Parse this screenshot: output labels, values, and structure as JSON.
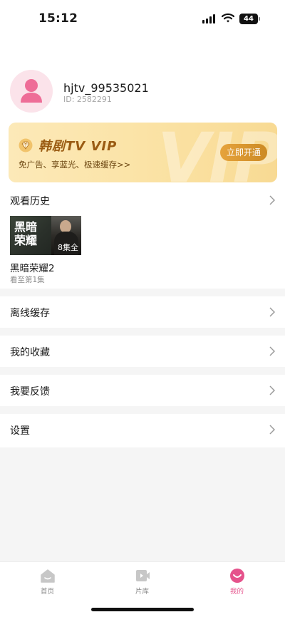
{
  "status_bar": {
    "time": "15:12",
    "battery": "44"
  },
  "profile": {
    "username": "hjtv_99535021",
    "user_id": "ID: 2582291"
  },
  "vip": {
    "title": "韩剧TV VIP",
    "description": "免广告、享蓝光、极速缓存>>",
    "button_label": "立即开通",
    "watermark": "VIP",
    "accent_color": "#cc8a24"
  },
  "history": {
    "section_label": "观看历史",
    "items": [
      {
        "thumb_title": "黑暗荣耀",
        "badge": "8集全",
        "title": "黑暗荣耀2",
        "progress": "看至第1集"
      }
    ]
  },
  "menu": {
    "offline_cache": "离线缓存",
    "favorites": "我的收藏",
    "feedback": "我要反馈",
    "settings": "设置"
  },
  "tabs": [
    {
      "label": "首页",
      "icon": "home-icon",
      "active": false
    },
    {
      "label": "片库",
      "icon": "video-library-icon",
      "active": false
    },
    {
      "label": "我的",
      "icon": "profile-face-icon",
      "active": true
    }
  ],
  "colors": {
    "brand_pink": "#e5528b",
    "avatar_bg": "#fbe3ea"
  }
}
